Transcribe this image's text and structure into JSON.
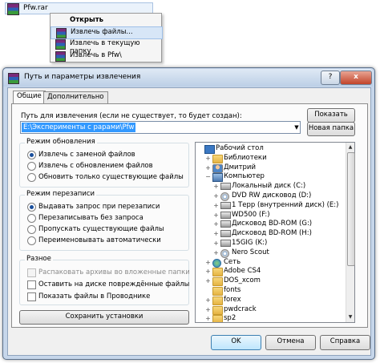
{
  "explorer": {
    "file_name": "Pfw.rar"
  },
  "context_menu": {
    "items": [
      {
        "label": "Открыть"
      },
      {
        "label": "Извлечь файлы..."
      },
      {
        "label": "Извлечь в текущую папку"
      },
      {
        "label": "Извлечь в Pfw\\"
      }
    ]
  },
  "dialog": {
    "title": "Путь и параметры извлечения",
    "help_button": "?",
    "close_button": "x",
    "tabs": [
      {
        "label": "Общие",
        "active": true
      },
      {
        "label": "Дополнительно",
        "active": false
      }
    ],
    "path_label": "Путь для извлечения (если не существует, то будет создан):",
    "path_value": "E:\\Эксперименты с рарами\\Pfw",
    "show_button": "Показать",
    "new_folder_button": "Новая папка",
    "update_mode": {
      "title": "Режим обновления",
      "options": [
        {
          "label": "Извлечь с заменой файлов",
          "selected": true
        },
        {
          "label": "Извлечь с обновлением файлов",
          "selected": false
        },
        {
          "label": "Обновить только существующие файлы",
          "selected": false
        }
      ]
    },
    "overwrite_mode": {
      "title": "Режим перезаписи",
      "options": [
        {
          "label": "Выдавать запрос при перезаписи",
          "selected": true
        },
        {
          "label": "Перезаписывать без запроса",
          "selected": false
        },
        {
          "label": "Пропускать существующие файлы",
          "selected": false
        },
        {
          "label": "Переименовывать автоматически",
          "selected": false
        }
      ]
    },
    "misc": {
      "title": "Разное",
      "options": [
        {
          "label": "Распаковать архивы во вложенные папки",
          "checked": false,
          "disabled": true
        },
        {
          "label": "Оставить на диске повреждённые файлы",
          "checked": false,
          "disabled": false
        },
        {
          "label": "Показать файлы в Проводнике",
          "checked": false,
          "disabled": false
        }
      ]
    },
    "save_settings_button": "Сохранить установки",
    "tree": [
      {
        "label": "Рабочий стол",
        "level": 0,
        "icon": "desktop-icon",
        "expander": ""
      },
      {
        "label": "Библиотеки",
        "level": 1,
        "icon": "folder-icon",
        "expander": "+"
      },
      {
        "label": "Дмитрий",
        "level": 1,
        "icon": "user-icon",
        "expander": "+"
      },
      {
        "label": "Компьютер",
        "level": 1,
        "icon": "computer-icon",
        "expander": "−"
      },
      {
        "label": "Локальный диск (C:)",
        "level": 2,
        "icon": "drive-icon",
        "expander": "+"
      },
      {
        "label": "DVD RW дисковод (D:)",
        "level": 2,
        "icon": "disc-icon",
        "expander": "+"
      },
      {
        "label": "1 Терр (внутренний диск) (E:)",
        "level": 2,
        "icon": "drive-icon",
        "expander": "+"
      },
      {
        "label": "WD500 (F:)",
        "level": 2,
        "icon": "drive-icon",
        "expander": "+"
      },
      {
        "label": "Дисковод BD-ROM (G:)",
        "level": 2,
        "icon": "drive-icon",
        "expander": "+"
      },
      {
        "label": "Дисковод BD-ROM (H:)",
        "level": 2,
        "icon": "drive-icon",
        "expander": "+"
      },
      {
        "label": "15GIG (K:)",
        "level": 2,
        "icon": "drive-icon",
        "expander": "+"
      },
      {
        "label": "Nero Scout",
        "level": 2,
        "icon": "disc-icon",
        "expander": "+"
      },
      {
        "label": "Сеть",
        "level": 1,
        "icon": "network-icon",
        "expander": "+"
      },
      {
        "label": "Adobe CS4",
        "level": 1,
        "icon": "folder-icon",
        "expander": "+"
      },
      {
        "label": "DOS_xcom",
        "level": 1,
        "icon": "folder-icon",
        "expander": "+"
      },
      {
        "label": "fonts",
        "level": 1,
        "icon": "folder-icon",
        "expander": ""
      },
      {
        "label": "forex",
        "level": 1,
        "icon": "folder-icon",
        "expander": "+"
      },
      {
        "label": "pwdcrack",
        "level": 1,
        "icon": "folder-icon",
        "expander": "+"
      },
      {
        "label": "sp2",
        "level": 1,
        "icon": "folder-icon",
        "expander": "+"
      }
    ],
    "ok_button": "OK",
    "cancel_button": "Отмена",
    "help_footer_button": "Справка"
  }
}
